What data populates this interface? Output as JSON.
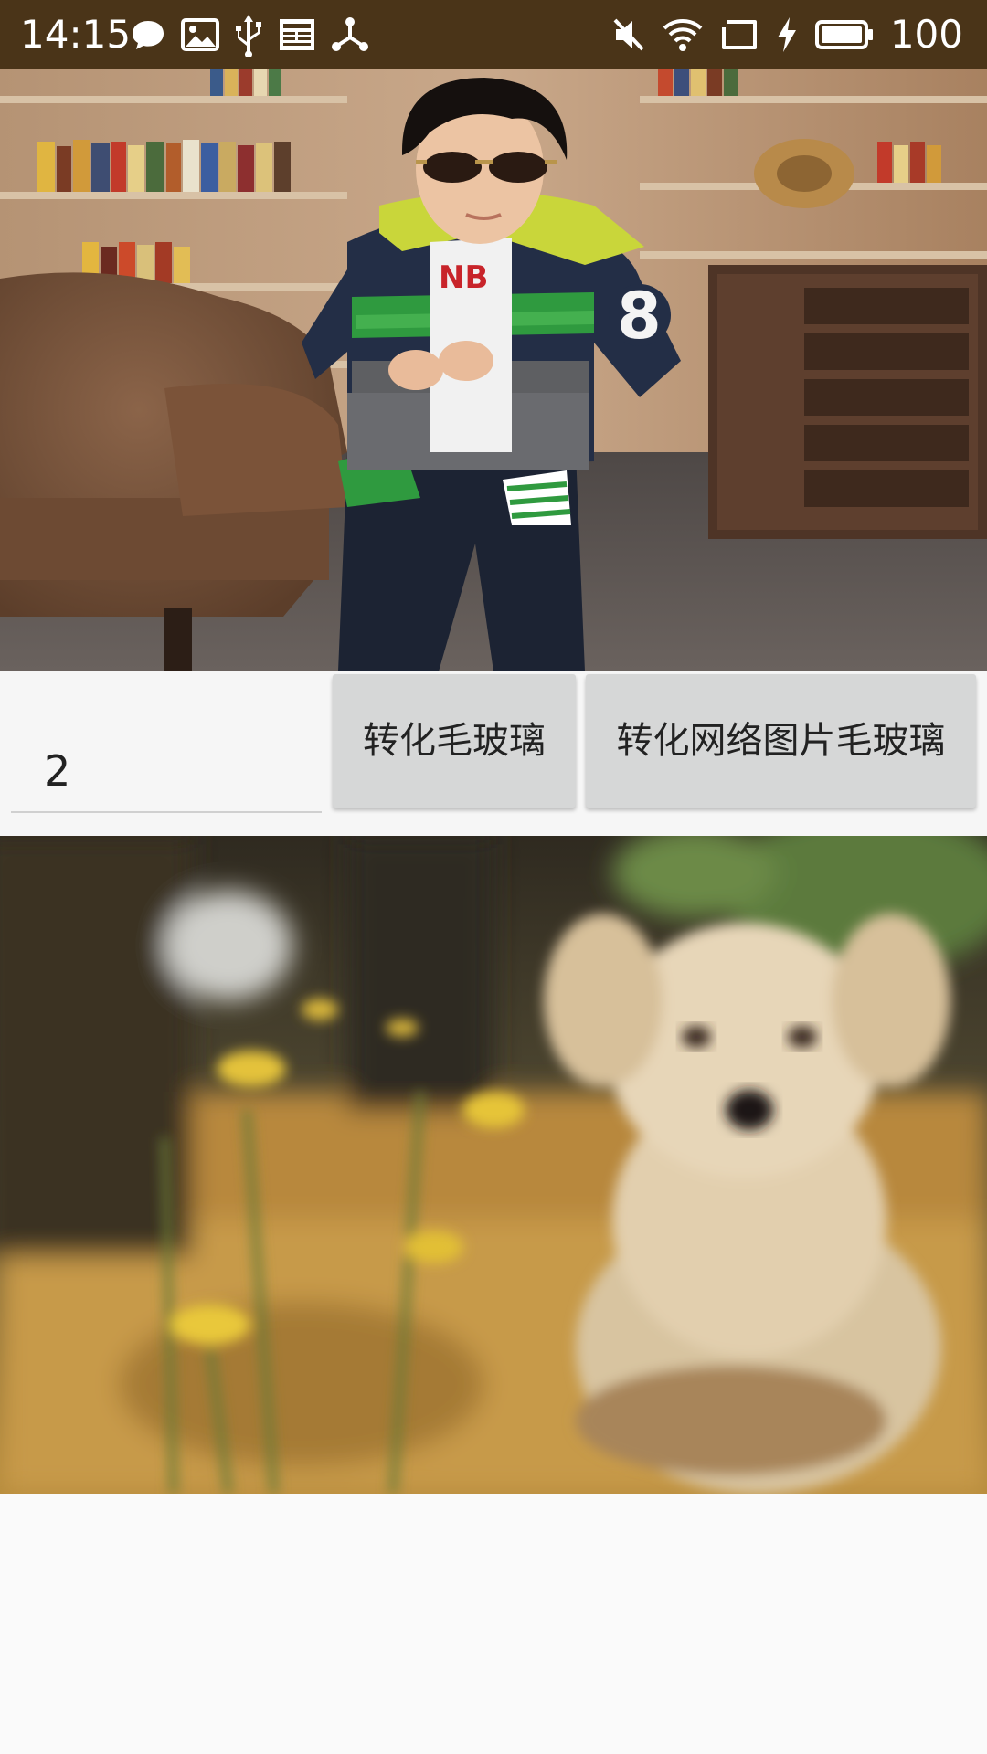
{
  "status_bar": {
    "time": "14:15",
    "battery_level": "100",
    "left_icons": [
      "chat-bubble-icon",
      "image-icon",
      "usb-icon",
      "news-icon",
      "share-node-icon"
    ],
    "right_icons": [
      "mute-icon",
      "wifi-icon",
      "cast-screen-icon",
      "charging-bolt-icon",
      "battery-icon"
    ],
    "background_color": "#4a3418"
  },
  "images": {
    "top_photo": "boy-in-sunglasses-photo",
    "bottom_photo": "blurred-puppy-photo"
  },
  "controls": {
    "radius_input_value": "2",
    "convert_button_label": "转化毛玻璃",
    "convert_network_button_label": "转化网络图片毛玻璃",
    "button_color": "#d6d7d7"
  }
}
